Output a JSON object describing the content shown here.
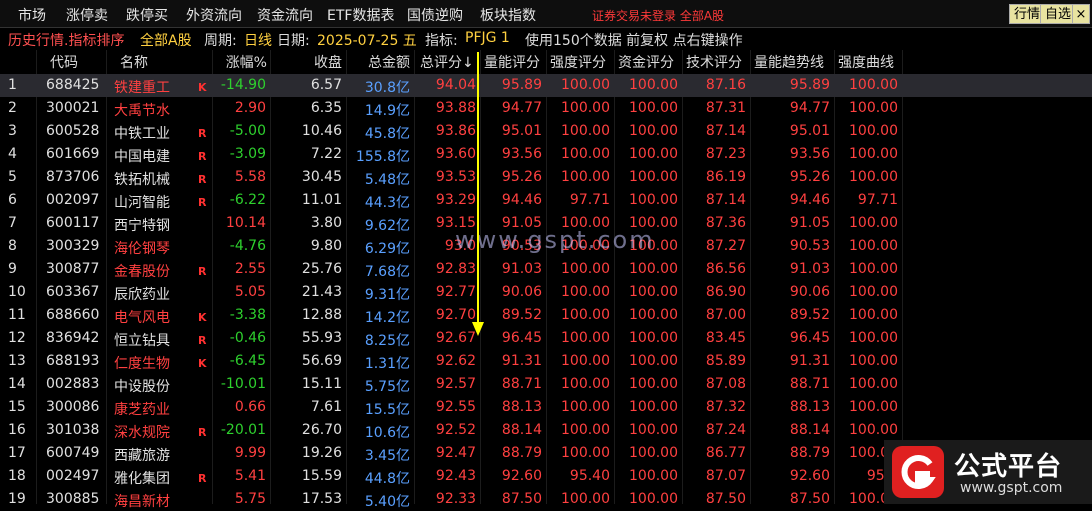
{
  "menu": {
    "items": [
      "市场",
      "涨停卖",
      "跌停买",
      "外资流向",
      "资金流向",
      "ETF数据表",
      "国债逆购",
      "板块指数"
    ],
    "login_text": "证券交易未登录  全部A股",
    "btn_market": "行情",
    "btn_favorite": "自选",
    "btn_close": "×"
  },
  "info": {
    "title": "历史行情.指标排序",
    "scope": "全部A股",
    "period_label": "周期:",
    "period_value": "日线",
    "date_label": "日期:",
    "date_value": "2025-07-25 五",
    "indicator_label": "指标:",
    "indicator_value": "PFJG 1",
    "note": "使用150个数据 前复权 点右键操作"
  },
  "columns": [
    "代码",
    "名称",
    "",
    "涨幅%",
    "收盘",
    "总金额",
    "总评分↓",
    "量能评分",
    "强度评分",
    "资金评分",
    "技术评分",
    "量能趋势线",
    "强度曲线"
  ],
  "colors": {
    "up": "#ff4040",
    "down": "#2ed02e",
    "amount": "#5aa0ff",
    "score": "#ff4040",
    "tag": "#ff3030",
    "white": "#e0e0e0",
    "arrow": "#ffff00"
  },
  "rows": [
    {
      "no": "1",
      "code": "688425",
      "name": "铁建重工",
      "tag": "K",
      "chg": "-14.90",
      "close": "6.57",
      "amt": "30.8亿",
      "total": "94.04",
      "vol": "95.89",
      "str": "100.00",
      "cap": "100.00",
      "tech": "87.16",
      "volt": "95.89",
      "strc": "100.00",
      "dir": "down",
      "name_red": true
    },
    {
      "no": "2",
      "code": "300021",
      "name": "大禹节水",
      "tag": "",
      "chg": "2.90",
      "close": "6.35",
      "amt": "14.9亿",
      "total": "93.88",
      "vol": "94.77",
      "str": "100.00",
      "cap": "100.00",
      "tech": "87.31",
      "volt": "94.77",
      "strc": "100.00",
      "dir": "up",
      "name_red": true
    },
    {
      "no": "3",
      "code": "600528",
      "name": "中铁工业",
      "tag": "R",
      "chg": "-5.00",
      "close": "10.46",
      "amt": "45.8亿",
      "total": "93.86",
      "vol": "95.01",
      "str": "100.00",
      "cap": "100.00",
      "tech": "87.14",
      "volt": "95.01",
      "strc": "100.00",
      "dir": "down",
      "name_red": false
    },
    {
      "no": "4",
      "code": "601669",
      "name": "中国电建",
      "tag": "R",
      "chg": "-3.09",
      "close": "7.22",
      "amt": "155.8亿",
      "total": "93.60",
      "vol": "93.56",
      "str": "100.00",
      "cap": "100.00",
      "tech": "87.23",
      "volt": "93.56",
      "strc": "100.00",
      "dir": "down",
      "name_red": false
    },
    {
      "no": "5",
      "code": "873706",
      "name": "铁拓机械",
      "tag": "R",
      "chg": "5.58",
      "close": "30.45",
      "amt": "5.48亿",
      "total": "93.53",
      "vol": "95.26",
      "str": "100.00",
      "cap": "100.00",
      "tech": "86.19",
      "volt": "95.26",
      "strc": "100.00",
      "dir": "up",
      "name_red": false
    },
    {
      "no": "6",
      "code": "002097",
      "name": "山河智能",
      "tag": "R",
      "chg": "-6.22",
      "close": "11.01",
      "amt": "44.3亿",
      "total": "93.29",
      "vol": "94.46",
      "str": "97.71",
      "cap": "100.00",
      "tech": "87.14",
      "volt": "94.46",
      "strc": "97.71",
      "dir": "down",
      "name_red": false
    },
    {
      "no": "7",
      "code": "600117",
      "name": "西宁特钢",
      "tag": "",
      "chg": "10.14",
      "close": "3.80",
      "amt": "9.62亿",
      "total": "93.15",
      "vol": "91.05",
      "str": "100.00",
      "cap": "100.00",
      "tech": "87.36",
      "volt": "91.05",
      "strc": "100.00",
      "dir": "up",
      "name_red": false
    },
    {
      "no": "8",
      "code": "300329",
      "name": "海伦钢琴",
      "tag": "",
      "chg": "-4.76",
      "close": "9.80",
      "amt": "6.29亿",
      "total": "93.0",
      "vol": "90.53",
      "str": "100.00",
      "cap": "100.00",
      "tech": "87.27",
      "volt": "90.53",
      "strc": "100.00",
      "dir": "down",
      "name_red": true
    },
    {
      "no": "9",
      "code": "300877",
      "name": "金春股份",
      "tag": "R",
      "chg": "2.55",
      "close": "25.76",
      "amt": "7.68亿",
      "total": "92.83",
      "vol": "91.03",
      "str": "100.00",
      "cap": "100.00",
      "tech": "86.56",
      "volt": "91.03",
      "strc": "100.00",
      "dir": "up",
      "name_red": true
    },
    {
      "no": "10",
      "code": "603367",
      "name": "辰欣药业",
      "tag": "",
      "chg": "5.05",
      "close": "21.43",
      "amt": "9.31亿",
      "total": "92.77",
      "vol": "90.06",
      "str": "100.00",
      "cap": "100.00",
      "tech": "86.90",
      "volt": "90.06",
      "strc": "100.00",
      "dir": "up",
      "name_red": false
    },
    {
      "no": "11",
      "code": "688660",
      "name": "电气风电",
      "tag": "K",
      "chg": "-3.38",
      "close": "12.88",
      "amt": "14.2亿",
      "total": "92.70",
      "vol": "89.52",
      "str": "100.00",
      "cap": "100.00",
      "tech": "87.00",
      "volt": "89.52",
      "strc": "100.00",
      "dir": "down",
      "name_red": true
    },
    {
      "no": "12",
      "code": "836942",
      "name": "恒立钻具",
      "tag": "R",
      "chg": "-0.46",
      "close": "55.93",
      "amt": "8.25亿",
      "total": "92.67",
      "vol": "96.45",
      "str": "100.00",
      "cap": "100.00",
      "tech": "83.45",
      "volt": "96.45",
      "strc": "100.00",
      "dir": "down",
      "name_red": false
    },
    {
      "no": "13",
      "code": "688193",
      "name": "仁度生物",
      "tag": "K",
      "chg": "-6.45",
      "close": "56.69",
      "amt": "1.31亿",
      "total": "92.62",
      "vol": "91.31",
      "str": "100.00",
      "cap": "100.00",
      "tech": "85.89",
      "volt": "91.31",
      "strc": "100.00",
      "dir": "down",
      "name_red": true
    },
    {
      "no": "14",
      "code": "002883",
      "name": "中设股份",
      "tag": "",
      "chg": "-10.01",
      "close": "15.11",
      "amt": "5.75亿",
      "total": "92.57",
      "vol": "88.71",
      "str": "100.00",
      "cap": "100.00",
      "tech": "87.08",
      "volt": "88.71",
      "strc": "100.00",
      "dir": "down",
      "name_red": false
    },
    {
      "no": "15",
      "code": "300086",
      "name": "康芝药业",
      "tag": "",
      "chg": "0.66",
      "close": "7.61",
      "amt": "15.5亿",
      "total": "92.55",
      "vol": "88.13",
      "str": "100.00",
      "cap": "100.00",
      "tech": "87.32",
      "volt": "88.13",
      "strc": "100.00",
      "dir": "up",
      "name_red": true
    },
    {
      "no": "16",
      "code": "301038",
      "name": "深水规院",
      "tag": "R",
      "chg": "-20.01",
      "close": "26.70",
      "amt": "10.6亿",
      "total": "92.52",
      "vol": "88.14",
      "str": "100.00",
      "cap": "100.00",
      "tech": "87.24",
      "volt": "88.14",
      "strc": "100.00",
      "dir": "down",
      "name_red": true
    },
    {
      "no": "17",
      "code": "600749",
      "name": "西藏旅游",
      "tag": "",
      "chg": "9.99",
      "close": "19.26",
      "amt": "3.45亿",
      "total": "92.47",
      "vol": "88.79",
      "str": "100.00",
      "cap": "100.00",
      "tech": "86.77",
      "volt": "88.79",
      "strc": "100.00",
      "dir": "up",
      "name_red": false
    },
    {
      "no": "18",
      "code": "002497",
      "name": "雅化集团",
      "tag": "R",
      "chg": "5.41",
      "close": "15.59",
      "amt": "44.8亿",
      "total": "92.43",
      "vol": "92.60",
      "str": "95.40",
      "cap": "100.00",
      "tech": "87.07",
      "volt": "92.60",
      "strc": "95.4",
      "dir": "up",
      "name_red": false
    },
    {
      "no": "19",
      "code": "300885",
      "name": "海昌新材",
      "tag": "",
      "chg": "5.75",
      "close": "17.53",
      "amt": "5.40亿",
      "total": "92.33",
      "vol": "87.50",
      "str": "100.00",
      "cap": "100.00",
      "tech": "87.50",
      "volt": "87.50",
      "strc": "100.00",
      "dir": "up",
      "name_red": true
    }
  ],
  "watermark": "www.gspt.com",
  "logo": {
    "title": "公式平台",
    "url": "www.gspt.com"
  }
}
